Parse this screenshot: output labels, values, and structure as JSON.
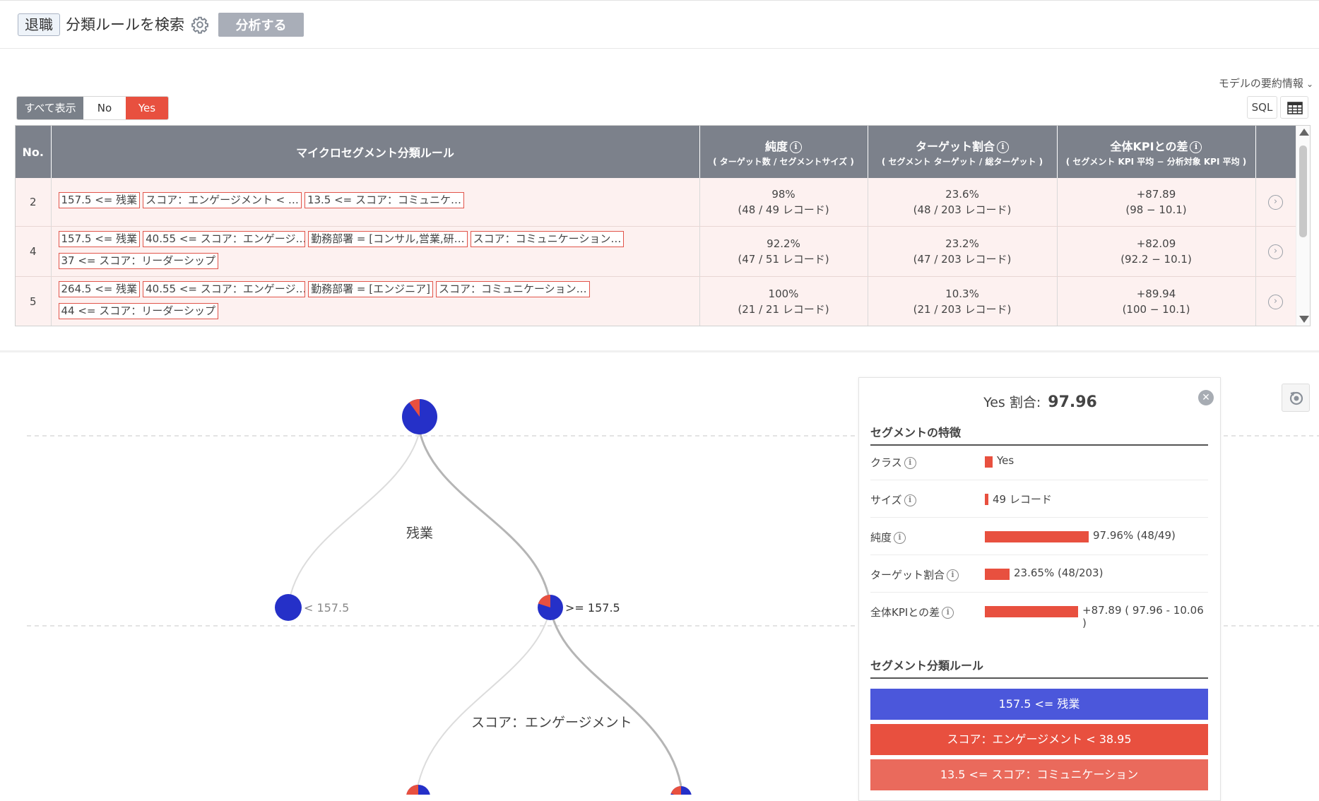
{
  "header": {
    "target": "退職",
    "title": "分類ルールを検索",
    "analyze_label": "分析する"
  },
  "toolbar": {
    "summary_link": "モデルの要約情報",
    "filters": {
      "all": "すべて表示",
      "no": "No",
      "yes": "Yes",
      "selected": "Yes"
    },
    "sql_label": "SQL"
  },
  "table": {
    "headers": {
      "no": "No.",
      "rule": "マイクロセグメント分類ルール",
      "purity": "純度",
      "purity_sub": "( ターゲット数 / セグメントサイズ )",
      "target_ratio": "ターゲット割合",
      "target_ratio_sub": "( セグメント ターゲット / 総ターゲット )",
      "kpi_diff": "全体KPIとの差",
      "kpi_diff_sub": "( セグメント KPI 平均 − 分析対象 KPI 平均 )"
    },
    "rows": [
      {
        "no": "2",
        "rules": [
          "157.5 <= 残業",
          "スコア：エンゲージメント < …",
          "13.5 <= スコア：コミュニケ…"
        ],
        "purity": "98%",
        "purity_detail": "(48 / 49 レコード)",
        "target_ratio": "23.6%",
        "target_ratio_detail": "(48 / 203 レコード)",
        "kpi_diff": "+87.89",
        "kpi_diff_detail": "(98 − 10.1)"
      },
      {
        "no": "4",
        "rules": [
          "157.5 <= 残業",
          "40.55 <= スコア：エンゲージ…",
          "勤務部署 = [コンサル,営業,研…",
          "スコア：コミュニケーション…",
          "37 <= スコア：リーダーシップ"
        ],
        "purity": "92.2%",
        "purity_detail": "(47 / 51 レコード)",
        "target_ratio": "23.2%",
        "target_ratio_detail": "(47 / 203 レコード)",
        "kpi_diff": "+82.09",
        "kpi_diff_detail": "(92.2 − 10.1)"
      },
      {
        "no": "5",
        "rules": [
          "264.5 <= 残業",
          "40.55 <= スコア：エンゲージ…",
          "勤務部署 = [エンジニア]",
          "スコア：コミュニケーション…",
          "44 <= スコア：リーダーシップ"
        ],
        "purity": "100%",
        "purity_detail": "(21 / 21 レコード)",
        "target_ratio": "10.3%",
        "target_ratio_detail": "(21 / 203 レコード)",
        "kpi_diff": "+89.94",
        "kpi_diff_detail": "(100 − 10.1)"
      }
    ]
  },
  "tree": {
    "split1": "残業",
    "left_label": "< 157.5",
    "right_label": ">= 157.5",
    "split2": "スコア：エンゲージメント",
    "colors": {
      "no": "#2530c8",
      "yes": "#e8503f"
    },
    "root_yes_fraction": 0.1,
    "right_yes_fraction": 0.2
  },
  "detail": {
    "ratio_label": "Yes 割合:",
    "ratio_value": "97.96",
    "features_title": "セグメントの特徴",
    "features": [
      {
        "key": "クラス",
        "value": "Yes",
        "bar_fraction": 0.07
      },
      {
        "key": "サイズ",
        "value": "49 レコード",
        "bar_fraction": 0.03
      },
      {
        "key": "純度",
        "value": "97.96% (48/49)",
        "bar_fraction": 0.9796
      },
      {
        "key": "ターゲット割合",
        "value": "23.65% (48/203)",
        "bar_fraction": 0.2365
      },
      {
        "key": "全体KPIとの差",
        "value": "+87.89 ( 97.96 - 10.06 )",
        "bar_fraction": 0.8789
      }
    ],
    "rules_title": "セグメント分類ルール",
    "rules": [
      "157.5 <= 残業",
      "スコア：エンゲージメント < 38.95",
      "13.5 <= スコア：コミュニケーション"
    ]
  }
}
